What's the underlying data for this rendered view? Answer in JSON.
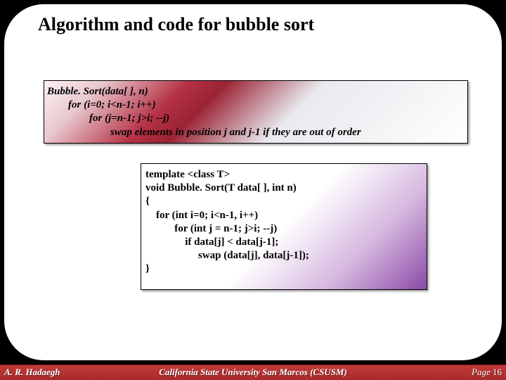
{
  "title": "Algorithm and code for bubble sort",
  "pseudo": {
    "l1": "Bubble. Sort(data[ ], n)",
    "l2": "        for (i=0; i<n-1; i++)",
    "l3": "                for (j=n-1; j>i; --j)",
    "l4": "                        swap elements in position j and j-1 if they are out of order"
  },
  "code": {
    "l1": "template <class T>",
    "l2": "void Bubble. Sort(T data[ ], int n)",
    "l3": "{",
    "l4": "    for (int i=0; i<n-1, i++)",
    "l5": "           for (int j = n-1; j>i; --j)",
    "l6": "               if data[j] < data[j-1];",
    "l7": "                    swap (data[j], data[j-1]);",
    "l8": "}"
  },
  "footer": {
    "author": "A. R. Hadaegh",
    "university": "California State University San Marcos (CSUSM)",
    "page_label": "Page",
    "page_num": "16"
  }
}
